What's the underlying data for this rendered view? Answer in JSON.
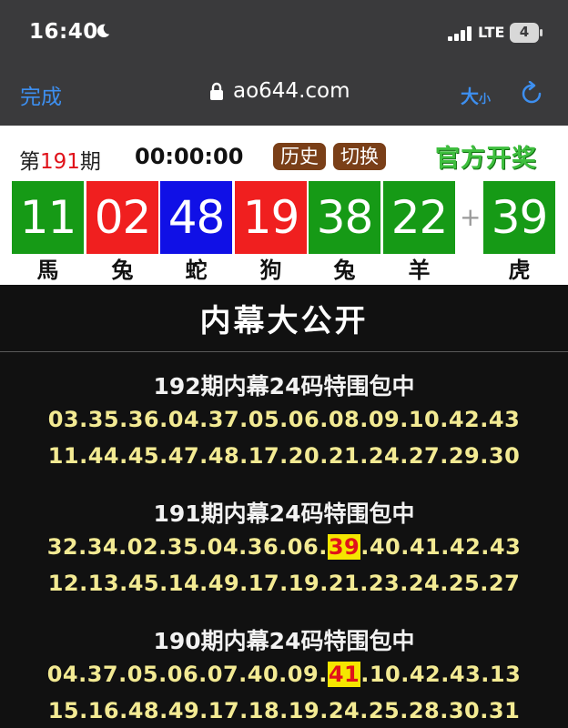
{
  "status_bar": {
    "time": "16:40",
    "network": "LTE",
    "battery": "4"
  },
  "browser": {
    "done_label": "完成",
    "url": "ao644.com",
    "text_size_big": "大",
    "text_size_small": "小"
  },
  "draw": {
    "period_prefix": "第",
    "period_number": "191",
    "period_suffix": "期",
    "countdown": "00:00:00",
    "history_label": "历史",
    "switch_label": "切换",
    "official_label": "官方开奖",
    "plus": "+",
    "balls": [
      {
        "number": "11",
        "zodiac": "馬",
        "color": "#169a16"
      },
      {
        "number": "02",
        "zodiac": "兔",
        "color": "#f01f1f"
      },
      {
        "number": "48",
        "zodiac": "蛇",
        "color": "#1010e6"
      },
      {
        "number": "19",
        "zodiac": "狗",
        "color": "#f01f1f"
      },
      {
        "number": "38",
        "zodiac": "兔",
        "color": "#169a16"
      },
      {
        "number": "22",
        "zodiac": "羊",
        "color": "#169a16"
      },
      {
        "number": "39",
        "zodiac": "虎",
        "color": "#169a16"
      }
    ]
  },
  "content": {
    "heading": "内幕大公开",
    "blocks": [
      {
        "title": "192期内幕24码特围包中",
        "line1": "03.35.36.04.37.05.06.08.09.10.42.43",
        "line2": "11.44.45.47.48.17.20.21.24.27.29.30"
      },
      {
        "title": "191期内幕24码特围包中",
        "line1_pre": "32.34.02.35.04.36.06.",
        "line1_hit": "39",
        "line1_post": ".40.41.42.43",
        "line2": "12.13.45.14.49.17.19.21.23.24.25.27"
      },
      {
        "title": "190期内幕24码特围包中",
        "line1_pre": "04.37.05.06.07.40.09.",
        "line1_hit": "41",
        "line1_post": ".10.42.43.13",
        "line2": "15.16.48.49.17.18.19.24.25.28.30.31"
      }
    ]
  }
}
